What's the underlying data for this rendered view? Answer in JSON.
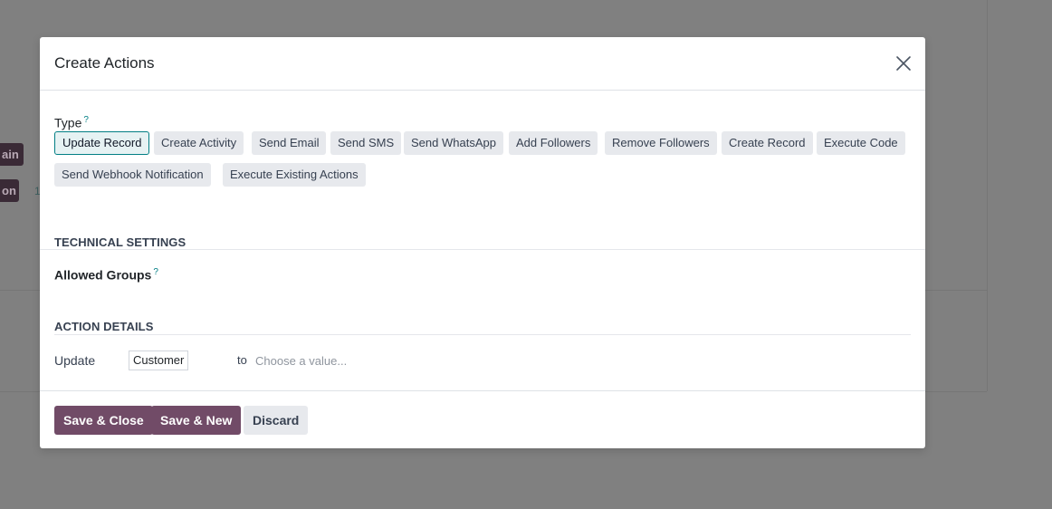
{
  "background": {
    "chip1": "ain",
    "chip2": "on",
    "digit": "1"
  },
  "modal": {
    "title": "Create Actions",
    "type_label": "Type",
    "help_mark": "?",
    "type_options": [
      "Update Record",
      "Create Activity",
      "Send Email",
      "Send SMS",
      "Send WhatsApp",
      "Add Followers",
      "Remove Followers",
      "Create Record",
      "Execute Code",
      "Send Webhook Notification",
      "Execute Existing Actions"
    ],
    "selected_type": "Update Record",
    "technical_settings_title": "TECHNICAL SETTINGS",
    "allowed_groups_label": "Allowed Groups",
    "action_details_title": "ACTION DETAILS",
    "update_label": "Update",
    "update_field": "Customer",
    "to_label": "to",
    "value_placeholder": "Choose a value...",
    "value": ""
  },
  "footer": {
    "save_close": "Save & Close",
    "save_new": "Save & New",
    "discard": "Discard"
  },
  "colors": {
    "primary": "#714b67",
    "accent": "#017e84",
    "backdrop": "#808080"
  }
}
